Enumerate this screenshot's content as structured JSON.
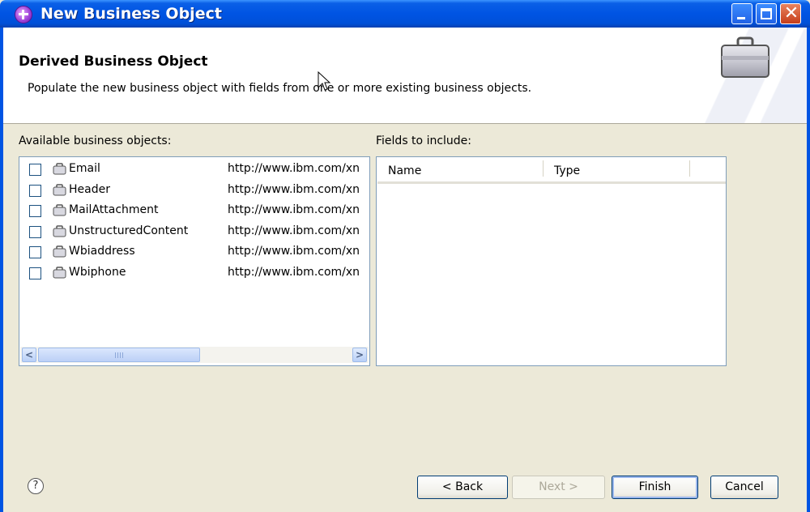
{
  "window": {
    "title": "New Business Object"
  },
  "banner": {
    "title": "Derived Business Object",
    "description": "Populate the new business object with fields from one or more existing business objects."
  },
  "available": {
    "label": "Available business objects:",
    "items": [
      {
        "name": "Email",
        "namespace": "http://www.ibm.com/xn"
      },
      {
        "name": "Header",
        "namespace": "http://www.ibm.com/xn"
      },
      {
        "name": "MailAttachment",
        "namespace": "http://www.ibm.com/xn"
      },
      {
        "name": "UnstructuredContent",
        "namespace": "http://www.ibm.com/xn"
      },
      {
        "name": "Wbiaddress",
        "namespace": "http://www.ibm.com/xn"
      },
      {
        "name": "Wbiphone",
        "namespace": "http://www.ibm.com/xn"
      }
    ]
  },
  "fields": {
    "label": "Fields to include:",
    "columns": [
      "Name",
      "Type"
    ]
  },
  "buttons": {
    "help": "?",
    "back": "< Back",
    "next": "Next >",
    "finish": "Finish",
    "cancel": "Cancel"
  },
  "icons": {
    "app": "business-object-app-icon",
    "banner": "briefcase-icon",
    "item": "business-object-icon"
  }
}
